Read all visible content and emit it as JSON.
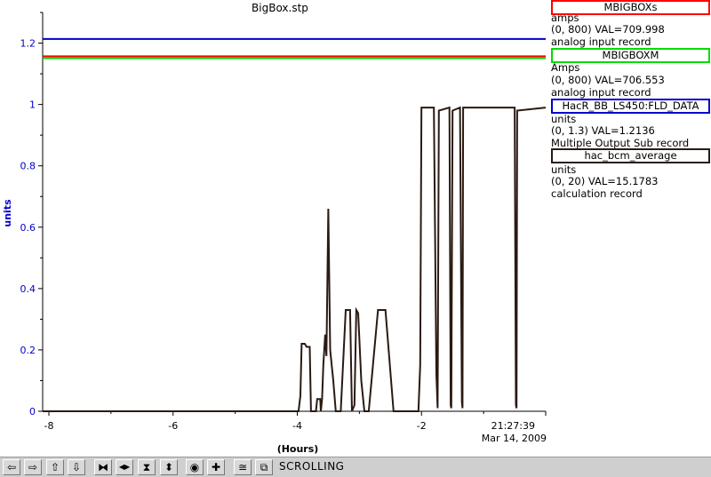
{
  "window": {
    "title": "BigBox.stp"
  },
  "chart_data": {
    "type": "line",
    "title": "BigBox.stp",
    "ylabel": "units",
    "xlabel": "(Hours)",
    "ylim": [
      0,
      1.3
    ],
    "xlim": [
      -8.1,
      0
    ],
    "yticks": [
      "0",
      "0.2",
      "0.4",
      "0.6",
      "0.8",
      "1",
      "1.2"
    ],
    "xticks": [
      "-8",
      "-6",
      "-4",
      "-2"
    ],
    "end_time": "21:27:39",
    "end_date": "Mar 14, 2009",
    "series": [
      {
        "name": "MBIGBOXs",
        "color": "#ff0000",
        "y": 1.157
      },
      {
        "name": "MBIGBOXM",
        "color": "#00dd00",
        "y": 1.151
      },
      {
        "name": "HacR_BB_LS450:FLD_DATA",
        "color": "#0000cc",
        "y": 1.2136
      },
      {
        "name": "hac_bcm_average",
        "color": "#2a1a12",
        "x": [
          -8.1,
          -3.98,
          -3.95,
          -3.93,
          -3.88,
          -3.85,
          -3.8,
          -3.78,
          -3.7,
          -3.68,
          -3.63,
          -3.62,
          -3.6,
          -3.58,
          -3.55,
          -3.53,
          -3.5,
          -3.47,
          -3.42,
          -3.38,
          -3.3,
          -3.22,
          -3.18,
          -3.15,
          -3.12,
          -3.08,
          -3.05,
          -3.02,
          -2.97,
          -2.92,
          -2.85,
          -2.7,
          -2.65,
          -2.62,
          -2.58,
          -2.45,
          -2.05,
          -2.02,
          -2.0,
          -1.95,
          -1.8,
          -1.76,
          -1.74,
          -1.72,
          -1.55,
          -1.53,
          -1.52,
          -1.5,
          -1.38,
          -1.35,
          -1.34,
          -1.33,
          -0.5,
          -0.48,
          -0.47,
          -0.46,
          0
        ],
        "y": [
          0.0,
          0.0,
          0.05,
          0.22,
          0.22,
          0.21,
          0.21,
          0.0,
          0.0,
          0.04,
          0.04,
          0.0,
          0.04,
          0.15,
          0.25,
          0.18,
          0.66,
          0.2,
          0.1,
          0.0,
          0.0,
          0.33,
          0.33,
          0.33,
          0.0,
          0.02,
          0.33,
          0.32,
          0.1,
          0.0,
          0.0,
          0.33,
          0.33,
          0.33,
          0.33,
          0.0,
          0.0,
          0.15,
          0.99,
          0.99,
          0.99,
          0.12,
          0.01,
          0.98,
          0.99,
          0.02,
          0.01,
          0.98,
          0.99,
          0.03,
          0.01,
          0.99,
          0.99,
          0.02,
          0.01,
          0.98,
          0.99
        ]
      }
    ]
  },
  "legend": [
    {
      "name": "MBIGBOXs",
      "color": "#ff0000",
      "units": "amps",
      "range": "(0, 800)  VAL=709.998",
      "type": "analog input record"
    },
    {
      "name": "MBIGBOXM",
      "color": "#00dd00",
      "units": "Amps",
      "range": "(0, 800) VAL=706.553",
      "type": "analog input record"
    },
    {
      "name": "HacR_BB_LS450:FLD_DATA",
      "color": "#0000cc",
      "units": "units",
      "range": "(0, 1.3) VAL=1.2136",
      "type": "Multiple Output Sub record"
    },
    {
      "name": "hac_bcm_average",
      "color": "#2a1a12",
      "units": "units",
      "range": "(0, 20) VAL=15.1783",
      "type": "calculation record"
    }
  ],
  "toolbar": {
    "buttons": [
      {
        "name": "scroll-left-button",
        "glyph": "⇦"
      },
      {
        "name": "scroll-right-button",
        "glyph": "⇨"
      },
      {
        "name": "scroll-up-button",
        "glyph": "⇧"
      },
      {
        "name": "scroll-down-button",
        "glyph": "⇩"
      },
      {
        "name": "compress-x-button",
        "glyph": "⧓"
      },
      {
        "name": "expand-x-button",
        "glyph": "◀▶"
      },
      {
        "name": "compress-y-button",
        "glyph": "⧗"
      },
      {
        "name": "expand-y-button",
        "glyph": "⬍"
      },
      {
        "name": "stop-button",
        "glyph": "◉"
      },
      {
        "name": "add-button",
        "glyph": "✚"
      },
      {
        "name": "zoom-fit-button",
        "glyph": "≅"
      },
      {
        "name": "snapshot-button",
        "glyph": "⧉"
      }
    ],
    "mode": "SCROLLING"
  }
}
